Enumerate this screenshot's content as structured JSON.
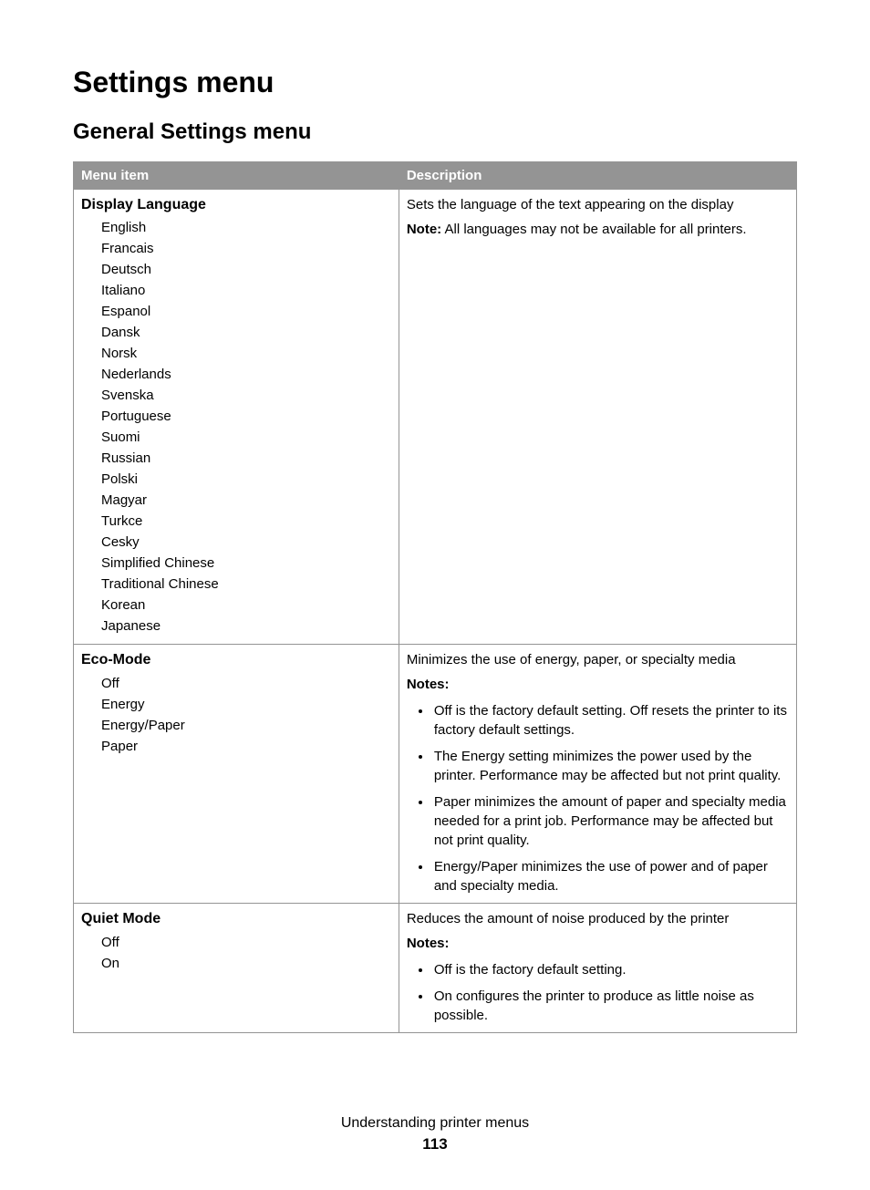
{
  "headings": {
    "page_title": "Settings menu",
    "section_title": "General Settings menu"
  },
  "table": {
    "header": {
      "col1": "Menu item",
      "col2": "Description"
    },
    "rows": [
      {
        "title": "Display Language",
        "options": [
          "English",
          "Francais",
          "Deutsch",
          "Italiano",
          "Espanol",
          "Dansk",
          "Norsk",
          "Nederlands",
          "Svenska",
          "Portuguese",
          "Suomi",
          "Russian",
          "Polski",
          "Magyar",
          "Turkce",
          "Cesky",
          "Simplified Chinese",
          "Traditional Chinese",
          "Korean",
          "Japanese"
        ],
        "description": {
          "lead": "Sets the language of the text appearing on the display",
          "note_prefix": "Note:",
          "note_text": " All languages may not be available for all printers."
        }
      },
      {
        "title": "Eco-Mode",
        "options": [
          "Off",
          "Energy",
          "Energy/Paper",
          "Paper"
        ],
        "description": {
          "lead": "Minimizes the use of energy, paper, or specialty media",
          "notes_label": "Notes:",
          "bullets": [
            "Off is the factory default setting. Off resets the printer to its factory default settings.",
            "The Energy setting minimizes the power used by the printer. Performance may be affected but not print quality.",
            "Paper minimizes the amount of paper and specialty media needed for a print job. Performance may be affected but not print quality.",
            "Energy/Paper minimizes the use of power and of paper and specialty media."
          ]
        }
      },
      {
        "title": "Quiet Mode",
        "options": [
          "Off",
          "On"
        ],
        "description": {
          "lead": "Reduces the amount of noise produced by the printer",
          "notes_label": "Notes:",
          "bullets": [
            "Off is the factory default setting.",
            "On configures the printer to produce as little noise as possible."
          ]
        }
      }
    ]
  },
  "footer": {
    "chapter": "Understanding printer menus",
    "page_number": "113"
  }
}
